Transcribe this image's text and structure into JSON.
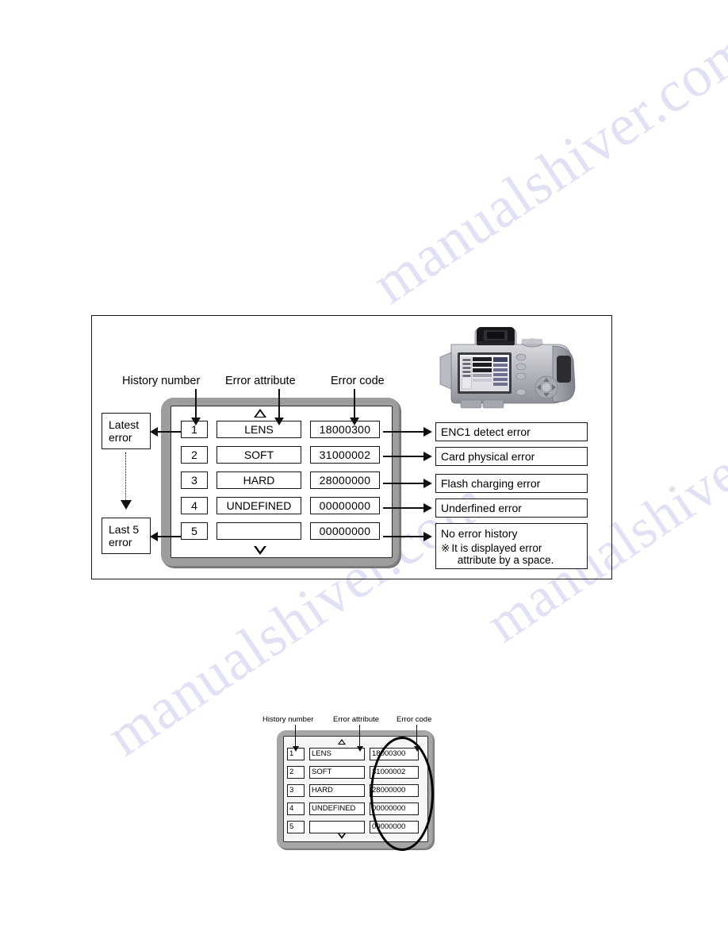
{
  "figure_main": {
    "column_labels": {
      "history_number": "History number",
      "error_attribute": "Error attribute",
      "error_code": "Error code"
    },
    "side_labels": {
      "latest": "Latest\nerror",
      "latest_line1": "Latest",
      "latest_line2": "error",
      "last5_line1": "Last 5",
      "last5_line2": "error"
    },
    "scroll_icons": {
      "up": "up-triangle",
      "down": "down-triangle"
    },
    "rows": [
      {
        "num": "1",
        "attribute": "LENS",
        "code": "18000300",
        "description": "ENC1 detect error"
      },
      {
        "num": "2",
        "attribute": "SOFT",
        "code": "31000002",
        "description": "Card physical error"
      },
      {
        "num": "3",
        "attribute": "HARD",
        "code": "28000000",
        "description": "Flash charging error"
      },
      {
        "num": "4",
        "attribute": "UNDEFINED",
        "code": "00000000",
        "description": "Underfined error"
      },
      {
        "num": "5",
        "attribute": "",
        "code": "00000000",
        "description": "No error history"
      }
    ],
    "note": {
      "mark": "※",
      "line1": "It is displayed error",
      "line2": "attribute by a space."
    },
    "camera": {
      "alt": "camera-rear-view"
    }
  },
  "figure_detail": {
    "column_labels": {
      "history_number": "History number",
      "error_attribute": "Error attribute",
      "error_code": "Error code"
    },
    "rows": [
      {
        "num": "1",
        "attribute": "LENS",
        "code": "18000300"
      },
      {
        "num": "2",
        "attribute": "SOFT",
        "code": "31000002"
      },
      {
        "num": "3",
        "attribute": "HARD",
        "code": "28000000"
      },
      {
        "num": "4",
        "attribute": "UNDEFINED",
        "code": "00000000"
      },
      {
        "num": "5",
        "attribute": "",
        "code": "00000000"
      }
    ],
    "highlight": "error-code-column-ellipse"
  },
  "watermark": {
    "text": "manualshiver.com",
    "color": "#c9c9ef"
  }
}
